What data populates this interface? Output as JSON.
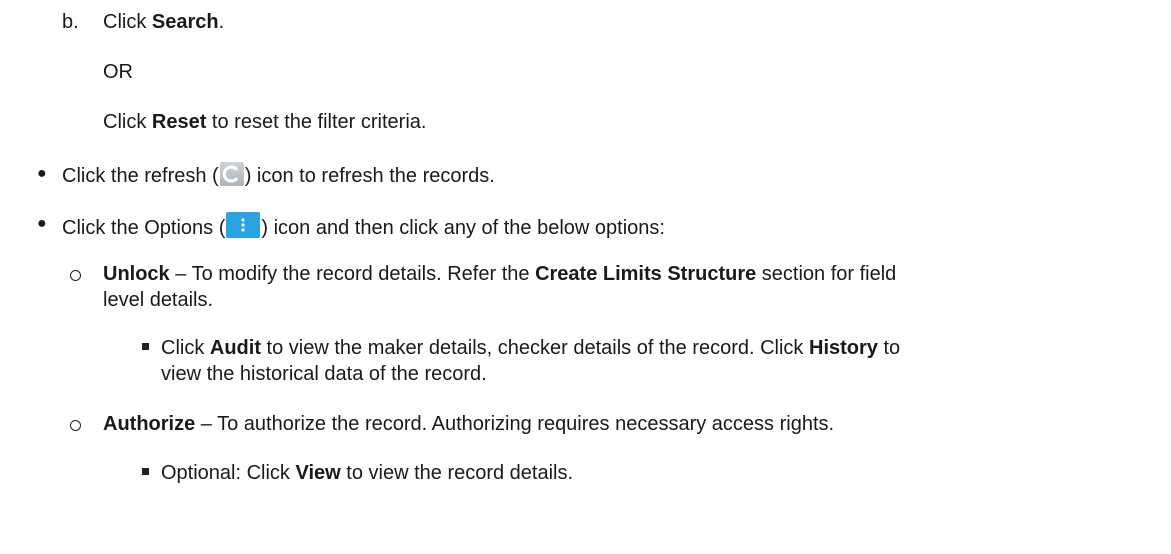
{
  "steps": {
    "b_marker": "b.",
    "b_click": "Click ",
    "b_search": "Search",
    "b_period": ".",
    "or": "OR",
    "reset_click": "Click ",
    "reset_label": "Reset",
    "reset_rest": " to reset the filter criteria."
  },
  "bullets": {
    "refresh_pre": "Click the refresh (",
    "refresh_post": ") icon to refresh the records.",
    "options_pre": "Click the Options (",
    "options_post": ") icon and then click any of the below options:"
  },
  "options": {
    "unlock_label": "Unlock",
    "unlock_text_a": " – To modify the record details. Refer the ",
    "unlock_ref": "Create Limits Structure",
    "unlock_text_b": " section for field",
    "unlock_text_c": "level details.",
    "audit_click": "Click ",
    "audit_label": "Audit",
    "audit_text": " to view the maker details, checker details of the record. Click ",
    "history_label": "History",
    "history_to": " to",
    "audit_text_c": "view the historical data of the record.",
    "authorize_label": "Authorize",
    "authorize_text": " – To authorize the record. Authorizing requires necessary access rights.",
    "view_pre": "Optional: Click ",
    "view_label": "View",
    "view_post": " to view the record details."
  },
  "icons": {
    "refresh": "refresh-icon",
    "options": "options-icon",
    "refresh_color": "#b7bcc0",
    "options_color": "#2aa3e0"
  }
}
